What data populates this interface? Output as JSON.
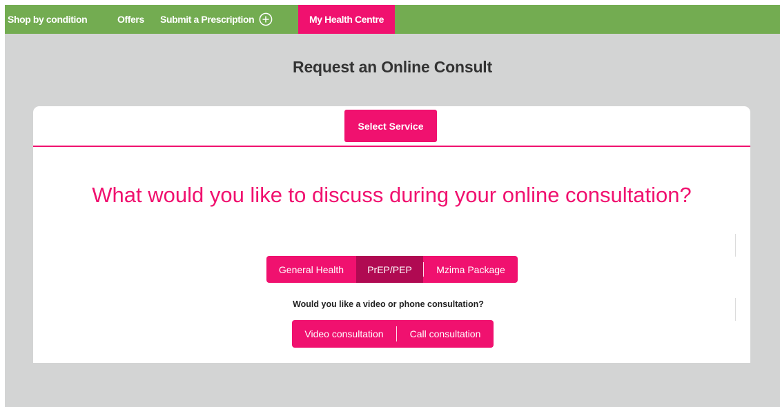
{
  "nav": {
    "shop_by_condition": "Shop by condition",
    "offers": "Offers",
    "submit_prescription": "Submit a Prescription",
    "my_health_centre": "My Health Centre"
  },
  "page": {
    "title": "Request an Online Consult"
  },
  "card": {
    "select_service_label": "Select Service",
    "question": "What would you like to discuss during your online consultation?",
    "services": [
      {
        "label": "General Health",
        "selected": false
      },
      {
        "label": "PrEP/PEP",
        "selected": true
      },
      {
        "label": "Mzima Package",
        "selected": false
      }
    ],
    "consult_question": "Would you like a video or phone consultation?",
    "consult_options": [
      {
        "label": "Video consultation"
      },
      {
        "label": "Call consultation"
      }
    ]
  },
  "colors": {
    "nav_green": "#73ac51",
    "brand_pink": "#f0116f",
    "selected_pink": "#b00a52",
    "page_grey": "#d3d4d4"
  },
  "icons": {
    "submit_prescription_icon": "plus-circle-icon"
  }
}
